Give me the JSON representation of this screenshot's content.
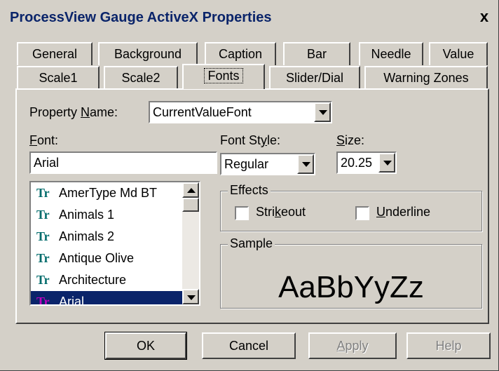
{
  "window": {
    "title": "ProcessView Gauge ActiveX Properties",
    "close_label": "x"
  },
  "tabs_row1": [
    {
      "label": "General"
    },
    {
      "label": "Background"
    },
    {
      "label": "Caption"
    },
    {
      "label": "Bar"
    },
    {
      "label": "Needle"
    },
    {
      "label": "Value"
    }
  ],
  "tabs_row2": [
    {
      "label": "Scale1"
    },
    {
      "label": "Scale2"
    },
    {
      "label": "Fonts",
      "active": true
    },
    {
      "label": "Slider/Dial"
    },
    {
      "label": "Warning Zones"
    }
  ],
  "property": {
    "label_pre": "Property ",
    "label_u": "N",
    "label_post": "ame:",
    "value": "CurrentValueFont"
  },
  "font": {
    "label_u": "F",
    "label_post": "ont:",
    "value": "Arial",
    "items": [
      {
        "name": "AmerType Md BT"
      },
      {
        "name": "Animals 1"
      },
      {
        "name": "Animals 2"
      },
      {
        "name": "Antique Olive"
      },
      {
        "name": "Architecture"
      },
      {
        "name": "Arial",
        "selected": true
      }
    ],
    "truetype_glyph": "Tr"
  },
  "font_style": {
    "label_pre": "Font St",
    "label_u": "y",
    "label_post": "le:",
    "value": "Regular"
  },
  "size": {
    "label_u": "S",
    "label_post": "ize:",
    "value": "20.25"
  },
  "effects": {
    "title": "Effects",
    "strikeout_pre": "Stri",
    "strikeout_u": "k",
    "strikeout_post": "eout",
    "underline_u": "U",
    "underline_post": "nderline",
    "strikeout_checked": false,
    "underline_checked": false
  },
  "sample": {
    "title": "Sample",
    "text": "AaBbYyZz"
  },
  "buttons": {
    "ok": "OK",
    "cancel": "Cancel",
    "apply_u": "A",
    "apply_post": "pply",
    "help": "Help"
  }
}
